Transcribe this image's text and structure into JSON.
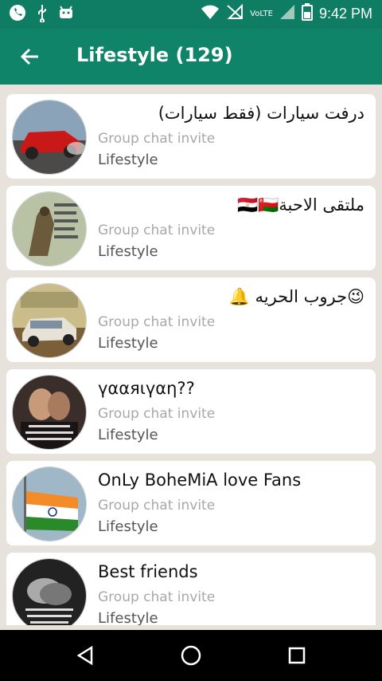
{
  "status_bar": {
    "time": "9:42 PM",
    "volte": "VoLTE",
    "icons": [
      "whatsapp-icon",
      "usb-icon",
      "android-icon",
      "wifi-icon",
      "no-signal-icon",
      "signal-icon",
      "battery-icon"
    ]
  },
  "toolbar": {
    "title": "Lifestyle (129)",
    "back_icon": "arrow-left-icon"
  },
  "groups": [
    {
      "name": "درفت سيارات (فقط سيارات)",
      "subtitle": "Group chat invite",
      "category": "Lifestyle",
      "rtl": true
    },
    {
      "name": "ملتقى الاحبة🇪🇬🇴🇲",
      "subtitle": "Group chat invite",
      "category": "Lifestyle",
      "rtl": true
    },
    {
      "name": "😉جروب الحريه 🔔",
      "subtitle": "Group chat invite",
      "category": "Lifestyle",
      "rtl": true
    },
    {
      "name": "үααяιүαη??",
      "subtitle": "Group chat invite",
      "category": "Lifestyle",
      "rtl": false
    },
    {
      "name": "OnLy BoheMiA love Fans",
      "subtitle": "Group chat invite",
      "category": "Lifestyle",
      "rtl": false
    },
    {
      "name": "Best friends",
      "subtitle": "Group chat invite",
      "category": "Lifestyle",
      "rtl": false
    }
  ],
  "nav": [
    "back-triangle-icon",
    "home-circle-icon",
    "recents-square-icon"
  ],
  "colors": {
    "toolbar": "#0f8468",
    "status_bar": "#0f7c64",
    "background": "#e7e2dc"
  }
}
